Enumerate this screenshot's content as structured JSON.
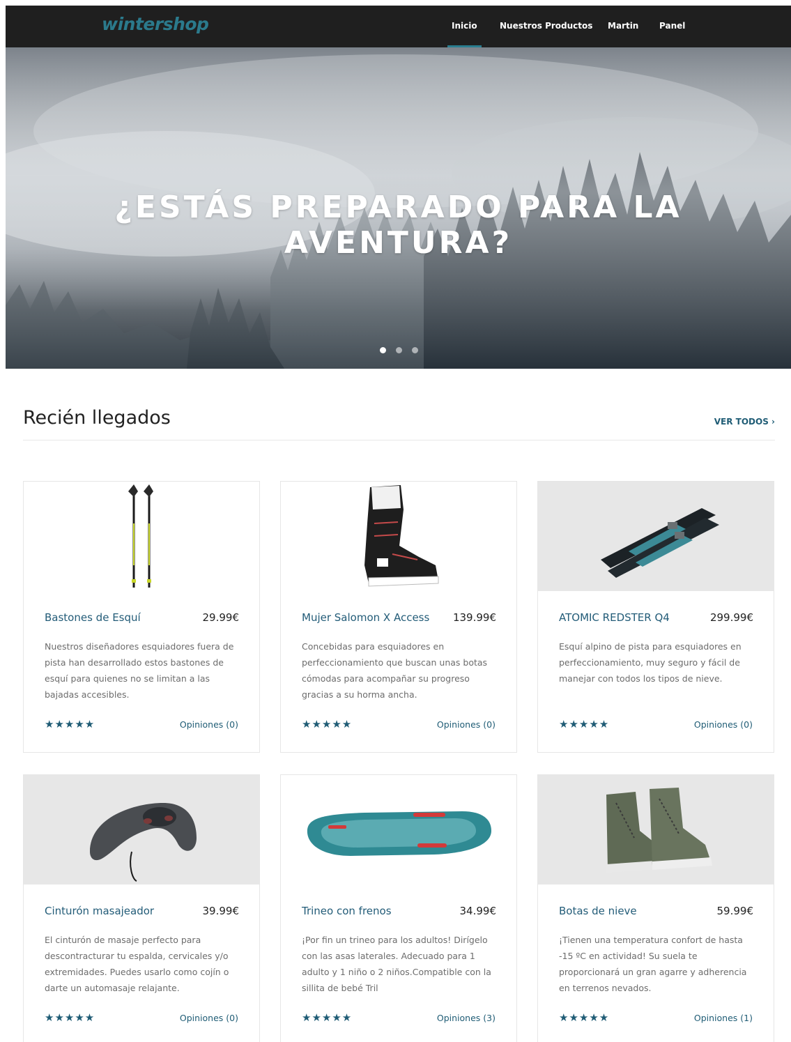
{
  "nav": {
    "logo": "wintershop",
    "items": [
      {
        "label": "Inicio",
        "active": true
      },
      {
        "label": "Nuestros Productos",
        "active": false
      },
      {
        "label": "Martin",
        "active": false
      },
      {
        "label": "Panel",
        "active": false
      }
    ],
    "accent": "#2a7d8f"
  },
  "hero": {
    "title": "¿ESTÁS PREPARADO PARA LA AVENTURA?",
    "slides": 3,
    "active_slide": 1
  },
  "section": {
    "title": "Recién llegados",
    "view_all": "VER TODOS",
    "view_all_icon": "chevron-right-icon"
  },
  "products": [
    {
      "name": "Bastones de Esquí",
      "price": "29.99€",
      "description": "Nuestros diseñadores esquiadores fuera de pista han desarrollado estos bastones de esquí para quienes no se limitan a las bajadas accesibles.",
      "stars": "★★★★★",
      "reviews": "Opiniones (0)"
    },
    {
      "name": "Mujer Salomon X Access",
      "price": "139.99€",
      "description": "Concebidas para esquiadores en perfeccionamiento que buscan unas botas cómodas para acompañar su progreso gracias a su horma ancha.",
      "stars": "★★★★★",
      "reviews": "Opiniones (0)"
    },
    {
      "name": "ATOMIC REDSTER Q4",
      "price": "299.99€",
      "description": "Esquí alpino de pista para esquiadores en perfeccionamiento, muy seguro y fácil de manejar con todos los tipos de nieve.",
      "stars": "★★★★★",
      "reviews": "Opiniones (0)"
    },
    {
      "name": "Cinturón masajeador",
      "price": "39.99€",
      "description": "El cinturón de masaje perfecto para descontracturar tu espalda, cervicales y/o extremidades. Puedes usarlo como cojín o darte un automasaje relajante.",
      "stars": "★★★★★",
      "reviews": "Opiniones (0)"
    },
    {
      "name": "Trineo con frenos",
      "price": "34.99€",
      "description": "¡Por fin un trineo para los adultos! Dirígelo con las asas laterales. Adecuado para 1 adulto y 1 niño o 2 niños.Compatible con la sillita de bebé Tril",
      "stars": "★★★★★",
      "reviews": "Opiniones (3)"
    },
    {
      "name": "Botas de nieve",
      "price": "59.99€",
      "description": "¡Tienen una temperatura confort de hasta -15 ºC en actividad! Su suela te proporcionará un gran agarre y adherencia en terrenos nevados.",
      "stars": "★★★★★",
      "reviews": "Opiniones (1)"
    }
  ]
}
